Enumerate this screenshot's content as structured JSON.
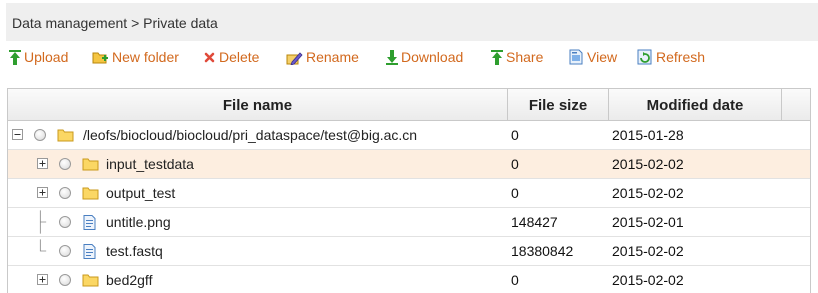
{
  "breadcrumb": {
    "text": "Data management > Private data"
  },
  "toolbar": {
    "upload": "Upload",
    "new_folder": "New folder",
    "delete": "Delete",
    "rename": "Rename",
    "download": "Download",
    "share": "Share",
    "view": "View",
    "refresh": "Refresh"
  },
  "table": {
    "headers": {
      "name": "File name",
      "size": "File size",
      "modified": "Modified date"
    },
    "rows": [
      {
        "name": "/leofs/biocloud/biocloud/pri_dataspace/test@big.ac.cn",
        "size": "0",
        "modified": "2015-01-28",
        "type": "folder"
      },
      {
        "name": "input_testdata",
        "size": "0",
        "modified": "2015-02-02",
        "type": "folder"
      },
      {
        "name": "output_test",
        "size": "0",
        "modified": "2015-02-02",
        "type": "folder"
      },
      {
        "name": "untitle.png",
        "size": "148427",
        "modified": "2015-02-01",
        "type": "file"
      },
      {
        "name": "test.fastq",
        "size": "18380842",
        "modified": "2015-02-02",
        "type": "file"
      },
      {
        "name": "bed2gff",
        "size": "0",
        "modified": "2015-02-02",
        "type": "folder"
      }
    ]
  },
  "colors": {
    "accent_text": "#d2691e",
    "highlight_row": "#fdeee0",
    "toolbar_green": "#2e9e2e"
  },
  "icons": {
    "upload": "arrow-up-icon",
    "new_folder": "folder-plus-icon",
    "delete": "x-icon",
    "rename": "pencil-icon",
    "download": "arrow-down-icon",
    "share": "share-icon",
    "view": "document-view-icon",
    "refresh": "refresh-icon"
  }
}
